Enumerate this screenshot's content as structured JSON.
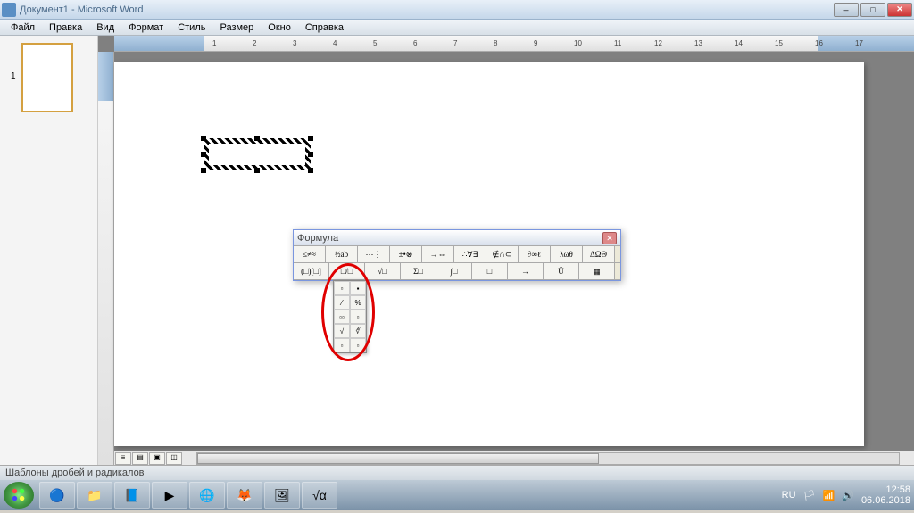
{
  "title": "Документ1 - Microsoft Word",
  "menu": [
    "Файл",
    "Правка",
    "Вид",
    "Формат",
    "Стиль",
    "Размер",
    "Окно",
    "Справка"
  ],
  "page_number": "1",
  "ruler_marks": [
    "1",
    "2",
    "3",
    "4",
    "5",
    "6",
    "7",
    "8",
    "9",
    "10",
    "11",
    "12",
    "13",
    "14",
    "15",
    "16",
    "17"
  ],
  "equation_window": {
    "title": "Формула",
    "row1": [
      "≤≠≈",
      "½ab",
      "⋯⋮",
      "±•⊗",
      "→⇔",
      "∴∀∃",
      "∉∩⊂",
      "∂∞ℓ",
      "λωθ",
      "ΔΩΘ"
    ],
    "row2": [
      "(□)[□]",
      "□/□",
      "√□",
      "Σ□",
      "∫□",
      "□̄",
      "→",
      "Ū",
      "▦"
    ]
  },
  "dropdown_items": [
    [
      "▫",
      "▪"
    ],
    [
      "⁄",
      "%"
    ],
    [
      "▫▫",
      "▫"
    ],
    [
      "√",
      "∛"
    ],
    [
      "▫",
      "▫"
    ]
  ],
  "status_text": "Шаблоны дробей и радикалов",
  "tray": {
    "lang": "RU",
    "time": "12:58",
    "date": "06.06.2018"
  }
}
